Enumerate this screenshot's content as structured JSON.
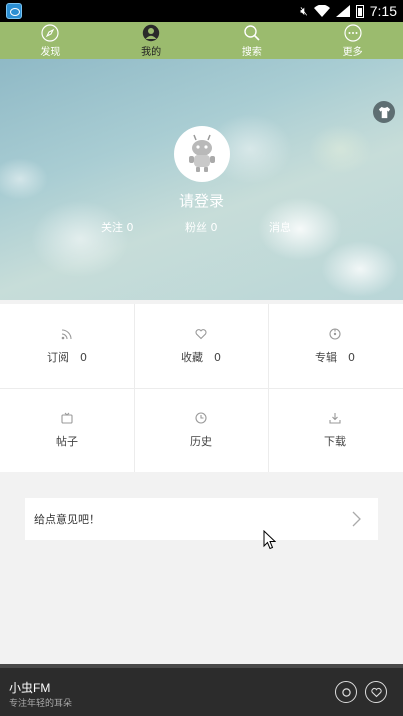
{
  "status_bar": {
    "time": "7:15"
  },
  "nav": {
    "tabs": [
      {
        "label": "发现",
        "icon": "compass-icon"
      },
      {
        "label": "我的",
        "icon": "user-icon",
        "active": true
      },
      {
        "label": "搜索",
        "icon": "search-icon"
      },
      {
        "label": "更多",
        "icon": "more-icon"
      }
    ]
  },
  "profile": {
    "login_text": "请登录",
    "follow": "关注 0",
    "fans": "粉丝 0",
    "messages": "消息"
  },
  "grid": {
    "subscribe": "订阅　0",
    "favorites": "收藏　0",
    "albums": "专辑　0",
    "posts": "帖子",
    "history": "历史",
    "downloads": "下载"
  },
  "feedback": {
    "label": "给点意见吧！"
  },
  "player": {
    "app_name": "小虫FM",
    "tagline": "专注年轻的耳朵"
  },
  "colors": {
    "nav_green": "#9bbb6e",
    "player_bg": "#2c2c2c"
  }
}
